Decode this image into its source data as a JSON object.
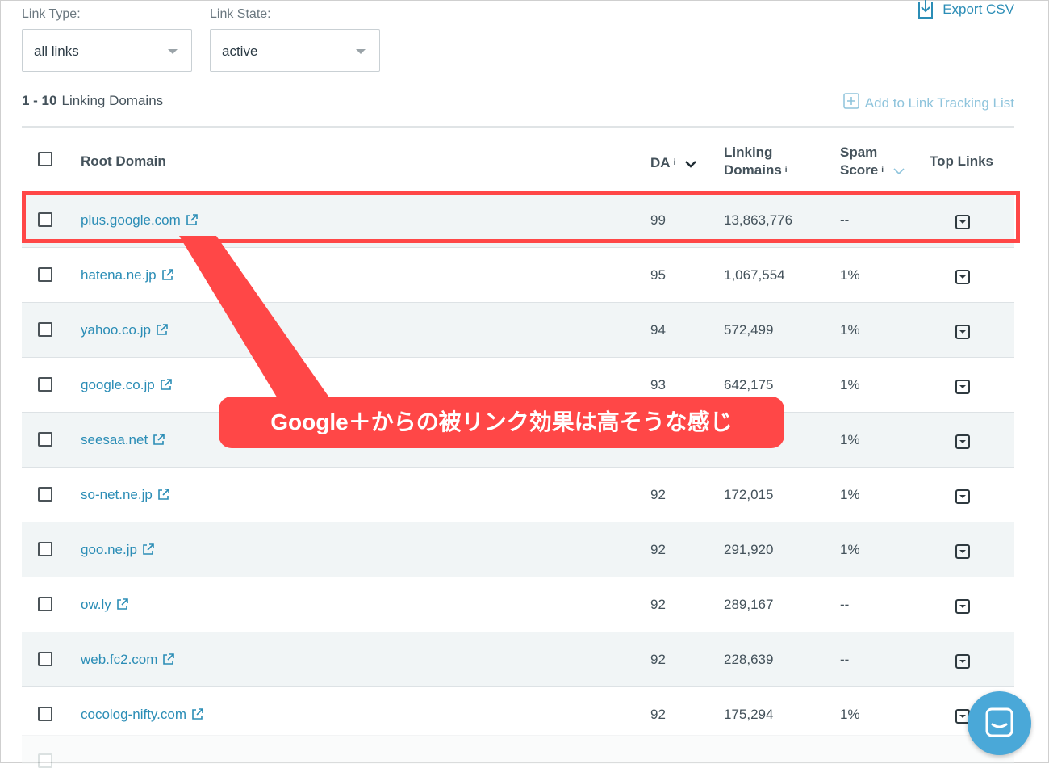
{
  "filters": {
    "link_type": {
      "label": "Link Type:",
      "value": "all links"
    },
    "link_state": {
      "label": "Link State:",
      "value": "active"
    }
  },
  "export_label": "Export CSV",
  "summary": {
    "range": "1 - 10",
    "text": "Linking Domains"
  },
  "add_tracking_label": "Add to Link Tracking List",
  "table": {
    "headers": {
      "root_domain": "Root Domain",
      "da": "DA",
      "linking_domains_line1": "Linking",
      "linking_domains_line2": "Domains",
      "spam_line1": "Spam",
      "spam_line2": "Score",
      "top_links": "Top Links",
      "info_glyph": "i"
    },
    "rows": [
      {
        "domain": "plus.google.com",
        "da": "99",
        "linking_domains": "13,863,776",
        "spam": "--"
      },
      {
        "domain": "hatena.ne.jp",
        "da": "95",
        "linking_domains": "1,067,554",
        "spam": "1%"
      },
      {
        "domain": "yahoo.co.jp",
        "da": "94",
        "linking_domains": "572,499",
        "spam": "1%"
      },
      {
        "domain": "google.co.jp",
        "da": "93",
        "linking_domains": "642,175",
        "spam": "1%"
      },
      {
        "domain": "seesaa.net",
        "da": "",
        "linking_domains": "",
        "spam": "1%"
      },
      {
        "domain": "so-net.ne.jp",
        "da": "92",
        "linking_domains": "172,015",
        "spam": "1%"
      },
      {
        "domain": "goo.ne.jp",
        "da": "92",
        "linking_domains": "291,920",
        "spam": "1%"
      },
      {
        "domain": "ow.ly",
        "da": "92",
        "linking_domains": "289,167",
        "spam": "--"
      },
      {
        "domain": "web.fc2.com",
        "da": "92",
        "linking_domains": "228,639",
        "spam": "--"
      },
      {
        "domain": "cocolog-nifty.com",
        "da": "92",
        "linking_domains": "175,294",
        "spam": "1%"
      }
    ]
  },
  "annotation": {
    "text": "Google＋からの被リンク効果は高そうな感じ",
    "color": "#ff4747"
  },
  "colors": {
    "link": "#2b8db6",
    "accent_light": "#8fc4dc",
    "chat": "#4aa8d8"
  }
}
